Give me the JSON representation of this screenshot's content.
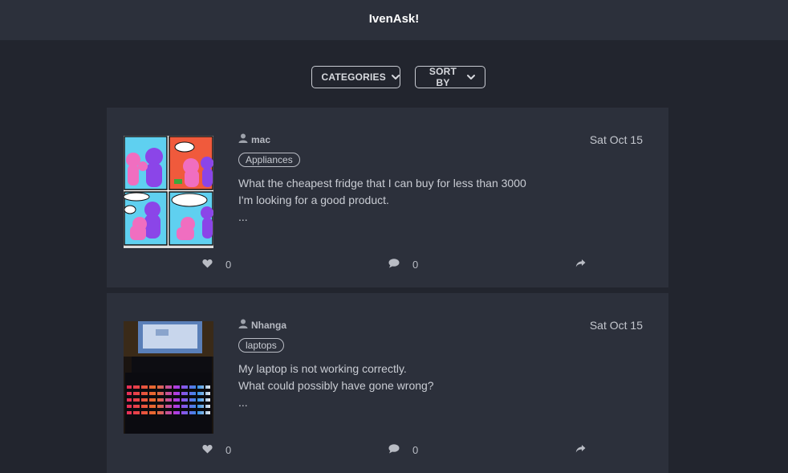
{
  "header": {
    "title": "IvenAsk!"
  },
  "filters": {
    "categories_label": "CATEGORIES",
    "sort_label": "SORT BY"
  },
  "posts": [
    {
      "author": "mac",
      "date": "Sat Oct 15",
      "tag": "Appliances",
      "lines": [
        "What the cheapest fridge that I can buy for less than 3000",
        "I'm looking for a good product.",
        "..."
      ],
      "likes": "0",
      "comments": "0",
      "image": "comic-strip-image"
    },
    {
      "author": "Nhanga",
      "date": "Sat Oct 15",
      "tag": "laptops",
      "lines": [
        "My laptop is not working correctly.",
        "What could possibly have gone wrong?",
        "..."
      ],
      "likes": "0",
      "comments": "0",
      "image": "laptop-keyboard-photo"
    }
  ],
  "icons": {
    "author": "user-icon",
    "like": "heart-icon",
    "comment": "comment-icon",
    "share": "share-icon",
    "dropdown": "chevron-down-icon"
  },
  "colors": {
    "background": "#22252e",
    "header": "#2c303b",
    "card": "#2c303b",
    "text": "#c9ccd3"
  }
}
